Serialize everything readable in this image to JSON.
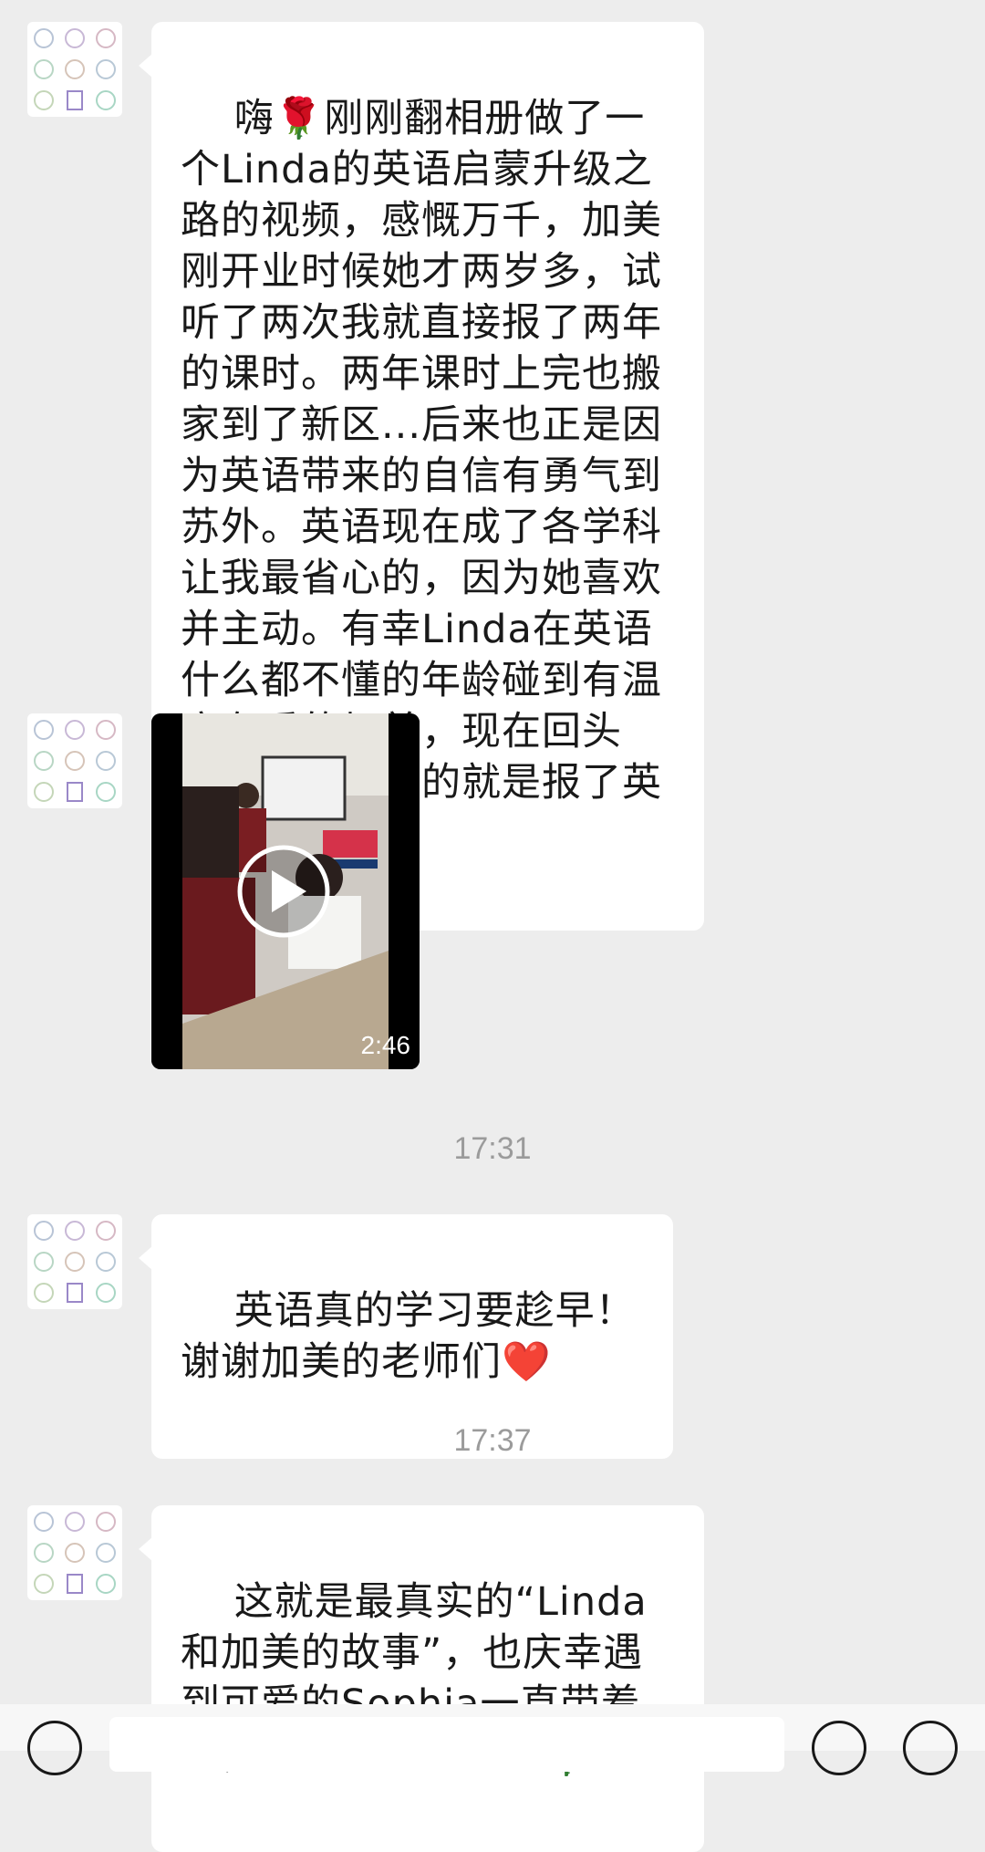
{
  "messages": [
    {
      "type": "text",
      "text": "嗨🌹刚刚翻相册做了一个Linda的英语启蒙升级之路的视频，感慨万千，加美刚开业时候她才两岁多，试听了两次我就直接报了两年的课时。两年课时上完也搬家到了新区...后来也正是因为英语带来的自信有勇气到苏外。英语现在成了各学科让我最省心的，因为她喜欢并主动。有幸Linda在英语什么都不懂的年龄碰到有温度有爱的加美，现在回头看，最不后悔的就是报了英语启蒙❤️👌"
    },
    {
      "type": "video",
      "duration": "2:46"
    },
    {
      "type": "time",
      "text": "17:31"
    },
    {
      "type": "text",
      "text": "英语真的学习要趁早！谢谢加美的老师们❤️"
    },
    {
      "type": "time",
      "text": "17:37"
    },
    {
      "type": "text",
      "text": "这就是最真实的“Linda和加美的故事”，也庆幸遇到可爱的Sophia一直带着她，祝加美越来越好🌹"
    }
  ],
  "avatar_icon": "sticker-grid-avatar-icon",
  "video_play_icon": "play-icon",
  "colors": {
    "background": "#ededed",
    "bubble": "#ffffff",
    "time": "#9b9b9b"
  }
}
